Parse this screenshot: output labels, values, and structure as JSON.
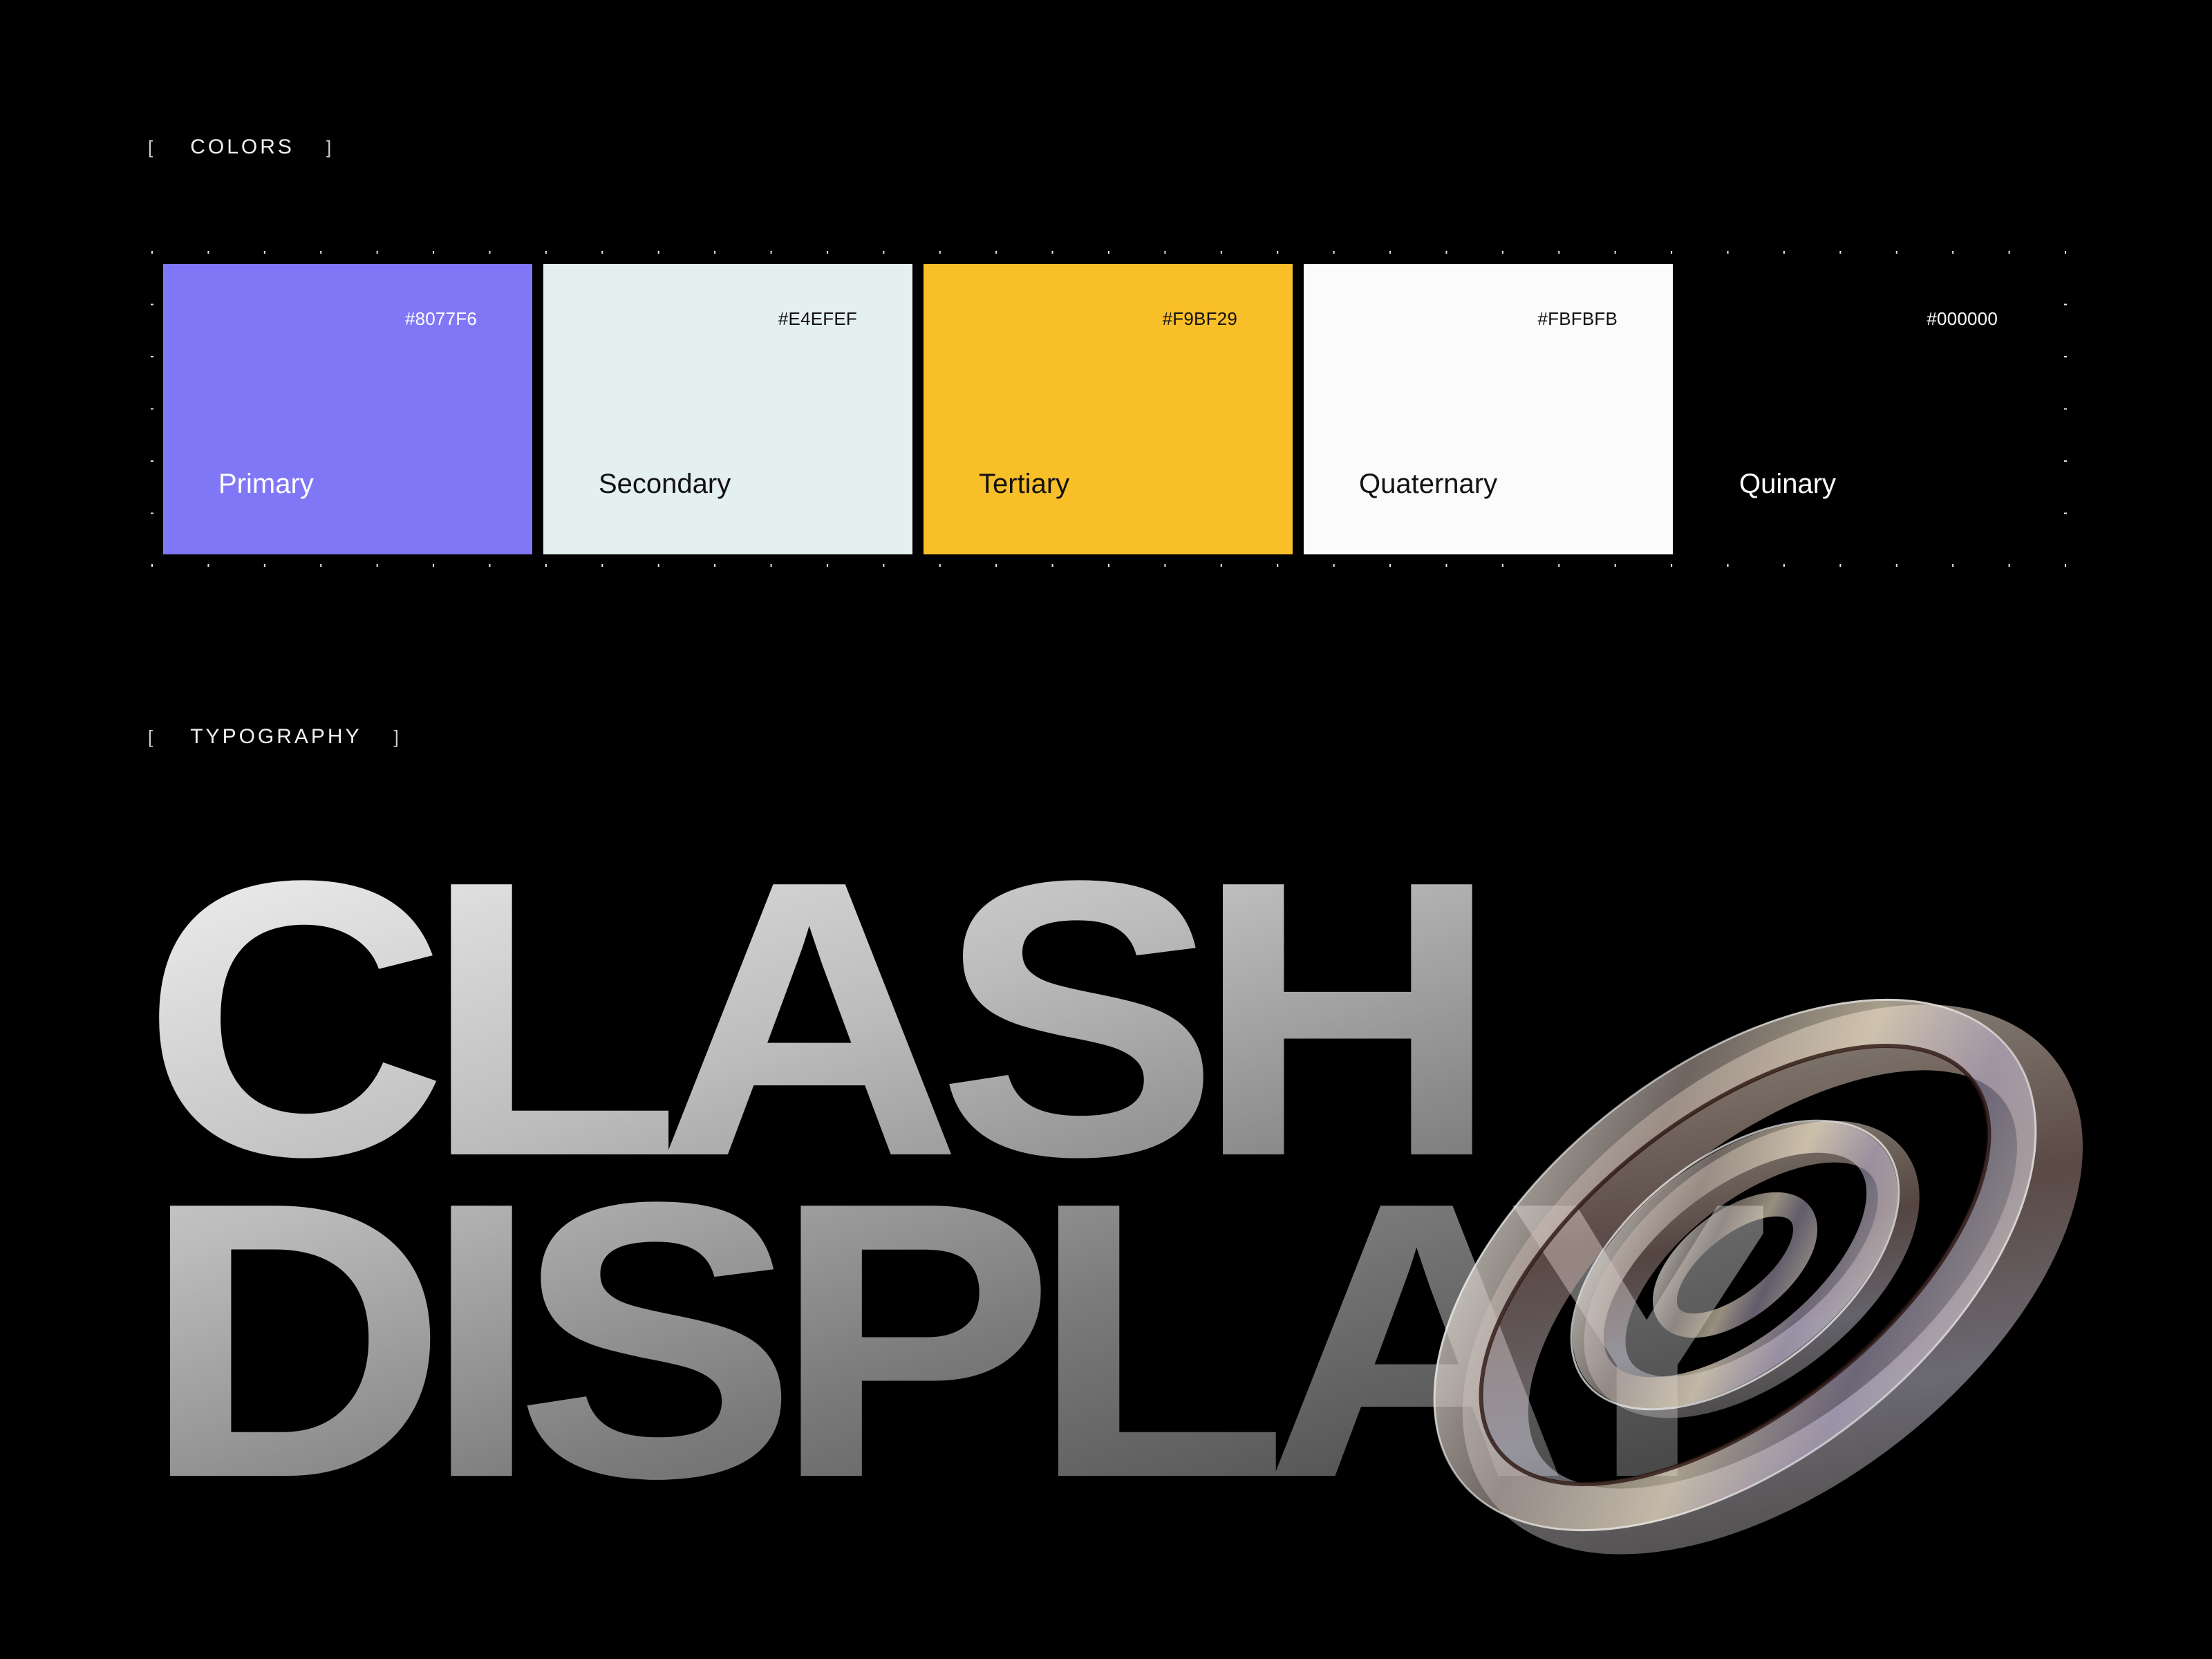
{
  "sections": {
    "colors": {
      "open": "[",
      "title": "COLORS",
      "close": "]"
    },
    "typography": {
      "open": "[",
      "title": "TYPOGRAPHY",
      "close": "]"
    }
  },
  "palette": [
    {
      "name": "Primary",
      "hex_label": "#8077F6",
      "color": "#8077F6",
      "text_color": "#FFFFFF"
    },
    {
      "name": "Secondary",
      "hex_label": "#E4EFEF",
      "color": "#E4EFEF",
      "text_color": "#111111"
    },
    {
      "name": "Tertiary",
      "hex_label": "#F9BF29",
      "color": "#F9BF29",
      "text_color": "#111111"
    },
    {
      "name": "Quaternary",
      "hex_label": "#FBFBFB",
      "color": "#FBFBFB",
      "text_color": "#111111"
    },
    {
      "name": "Quinary",
      "hex_label": "#000000",
      "color": "#000000",
      "text_color": "#FFFFFF"
    }
  ],
  "typography": {
    "line1": "CLASH",
    "line2": "DISPLAY",
    "decoration": "at-symbol-3d-glass"
  }
}
